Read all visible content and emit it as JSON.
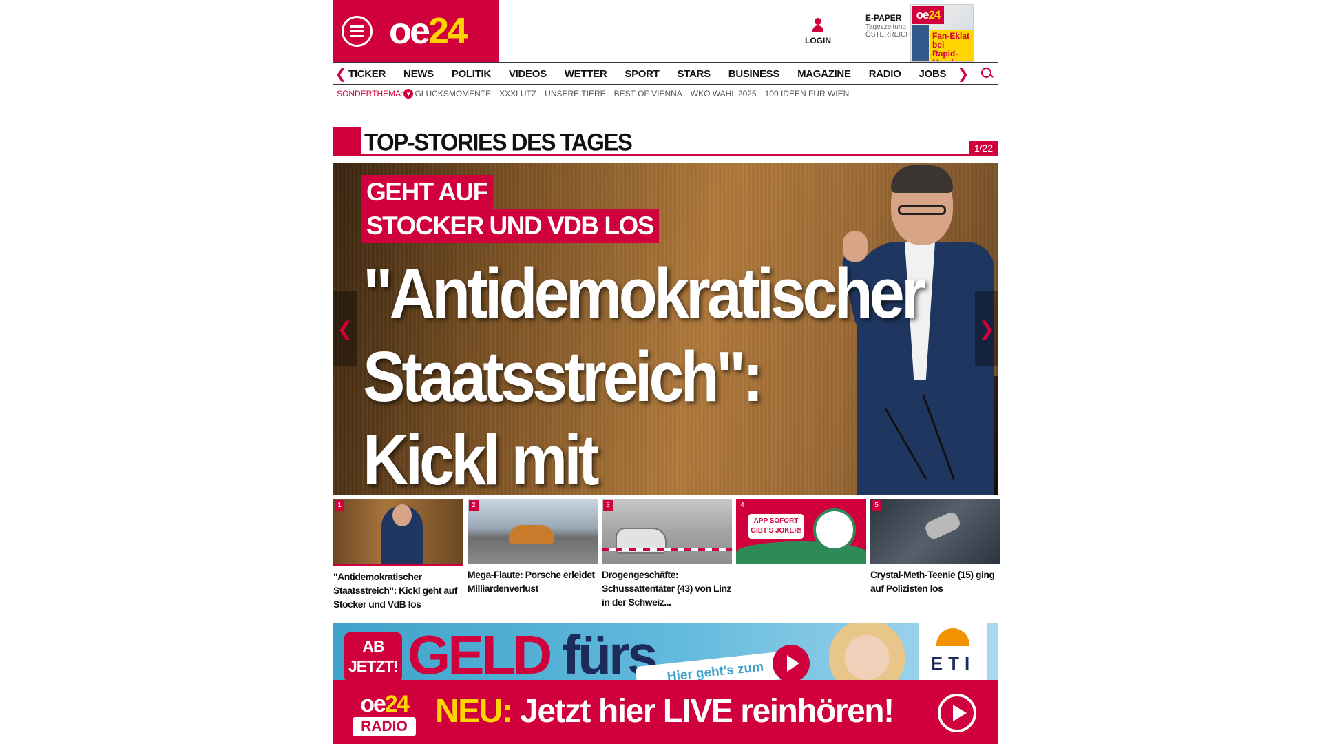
{
  "header": {
    "logo_main": "oe",
    "logo_highlight": "24",
    "login_label": "LOGIN",
    "epaper_title": "E-PAPER",
    "epaper_sub1": "Tageszeitung",
    "epaper_sub2": "ÖSTERREICH",
    "epaper_cover_logo_main": "oe",
    "epaper_cover_logo_highlight": "24",
    "epaper_cover_headline": "Fan-Eklat bei Rapid-Match"
  },
  "nav": {
    "items": [
      "TICKER",
      "NEWS",
      "POLITIK",
      "VIDEOS",
      "WETTER",
      "SPORT",
      "STARS",
      "BUSINESS",
      "MAGAZINE",
      "RADIO",
      "JOBS"
    ],
    "left_arrow": "❮",
    "right_arrow": "❯"
  },
  "subnav": {
    "label": "SONDERTHEMA:",
    "items": [
      "GLÜCKSMOMENTE",
      "XXXLUTZ",
      "UNSERE TIERE",
      "BEST OF VIENNA",
      "WKO WAHL 2025",
      "100 IDEEN FÜR WIEN"
    ]
  },
  "section": {
    "title": "TOP-STORIES DES TAGES",
    "counter": "1/22"
  },
  "hero": {
    "kicker_line1": "GEHT AUF",
    "kicker_line2": "STOCKER UND VDB LOS",
    "headline_line1": "\"Antidemokratischer",
    "headline_line2": "Staatsstreich\":",
    "headline_line3": "Kickl mit Rundumschlag",
    "arrow_left": "❮",
    "arrow_right": "❯"
  },
  "thumbs": [
    {
      "num": "1",
      "caption": "\"Antidemokratischer Staatsstreich\": Kickl geht auf Stocker und VdB los"
    },
    {
      "num": "2",
      "caption": "Mega-Flaute: Porsche erleidet Milliardenverlust"
    },
    {
      "num": "3",
      "caption": "Drogengeschäfte: Schussattentäter (43) von Linz in der Schweiz..."
    },
    {
      "num": "4",
      "caption": "",
      "ad_text": "APP SOFORT GIBT'S JOKER!"
    },
    {
      "num": "5",
      "caption": "Crystal-Meth-Teenie (15) ging auf Polizisten los"
    }
  ],
  "ad": {
    "ab_line1": "AB",
    "ab_line2": "JETZT!",
    "geld": "GELD",
    "furs": "fürs",
    "hier": "Hier geht's zum",
    "brand": "ETI"
  },
  "radio": {
    "logo_main": "oe",
    "logo_highlight": "24",
    "logo_label": "RADIO",
    "neu": "NEU:",
    "text": "Jetzt hier LIVE reinhören!"
  },
  "colors": {
    "brand_red": "#d0003c",
    "brand_yellow": "#ffd400"
  }
}
